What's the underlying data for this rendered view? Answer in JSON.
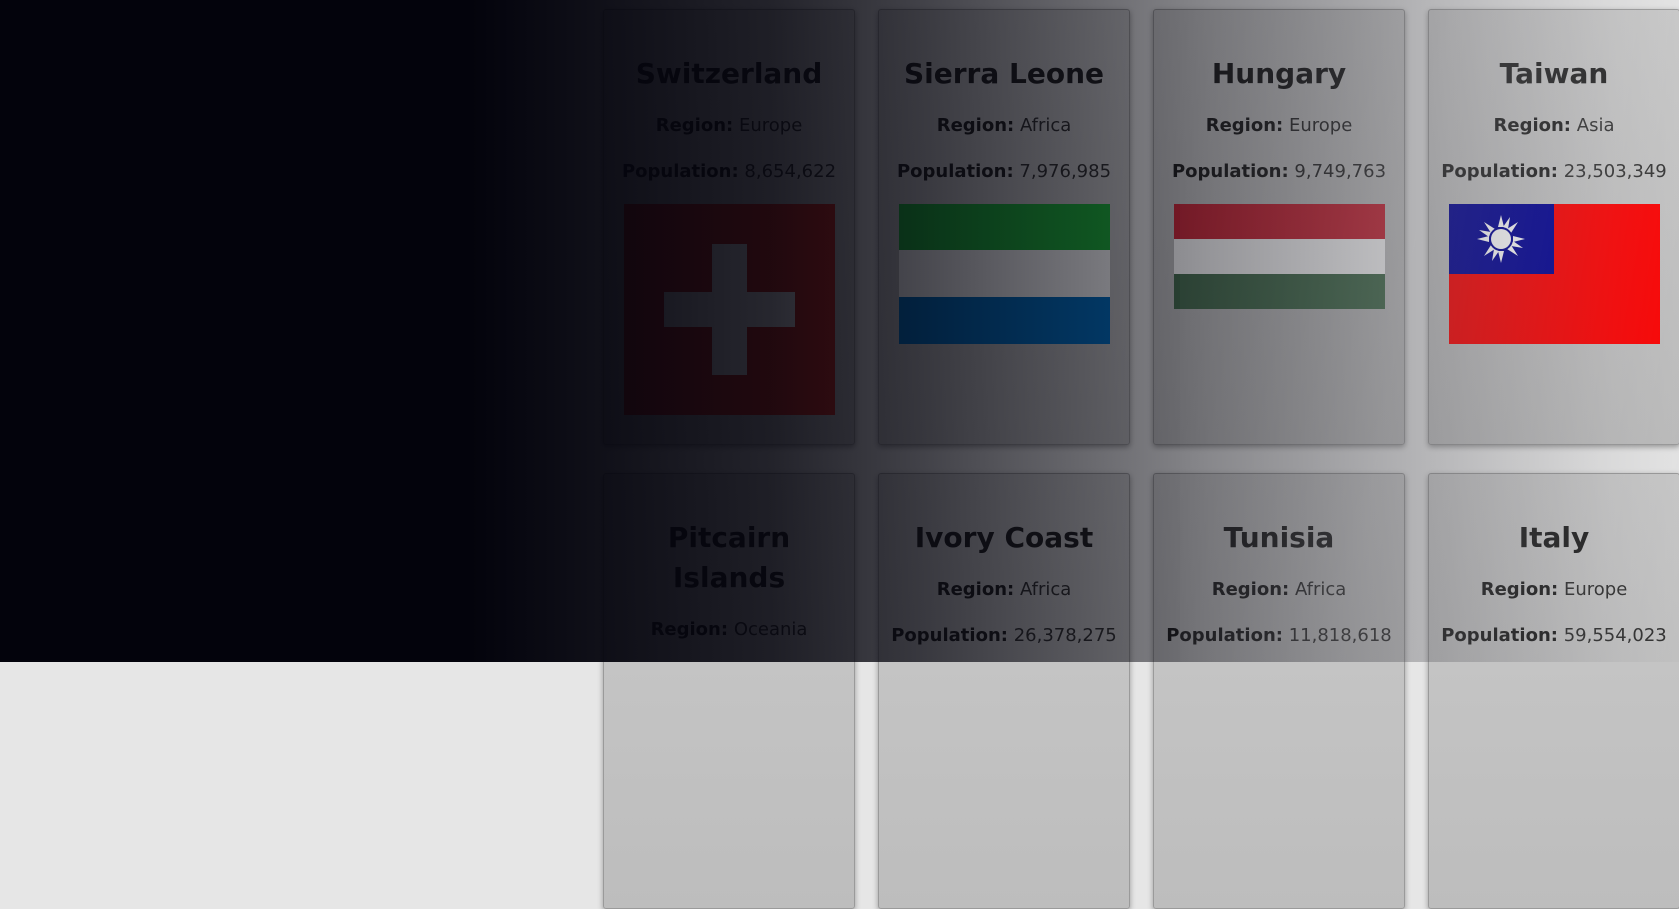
{
  "labels": {
    "region": "Region:",
    "population": "Population:"
  },
  "cards": [
    {
      "name": "Switzerland",
      "region": "Europe",
      "population": "8,654,622"
    },
    {
      "name": "Sierra Leone",
      "region": "Africa",
      "population": "7,976,985"
    },
    {
      "name": "Hungary",
      "region": "Europe",
      "population": "9,749,763"
    },
    {
      "name": "Taiwan",
      "region": "Asia",
      "population": "23,503,349"
    },
    {
      "name": "Pitcairn Islands",
      "region": "Oceania",
      "population": ""
    },
    {
      "name": "Ivory Coast",
      "region": "Africa",
      "population": "26,378,275"
    },
    {
      "name": "Tunisia",
      "region": "Africa",
      "population": "11,818,618"
    },
    {
      "name": "Italy",
      "region": "Europe",
      "population": "59,554,023"
    }
  ],
  "colors": {
    "background_dark": "#03030c",
    "card_bg": "#c4c4c4",
    "switzerland_red": "#d52b1e",
    "sierra_green": "#1eb53a",
    "sierra_blue": "#0072c6",
    "hungary_red": "#ce2939",
    "hungary_green": "#477050",
    "taiwan_red": "#fe0000",
    "taiwan_blue": "#000095"
  }
}
